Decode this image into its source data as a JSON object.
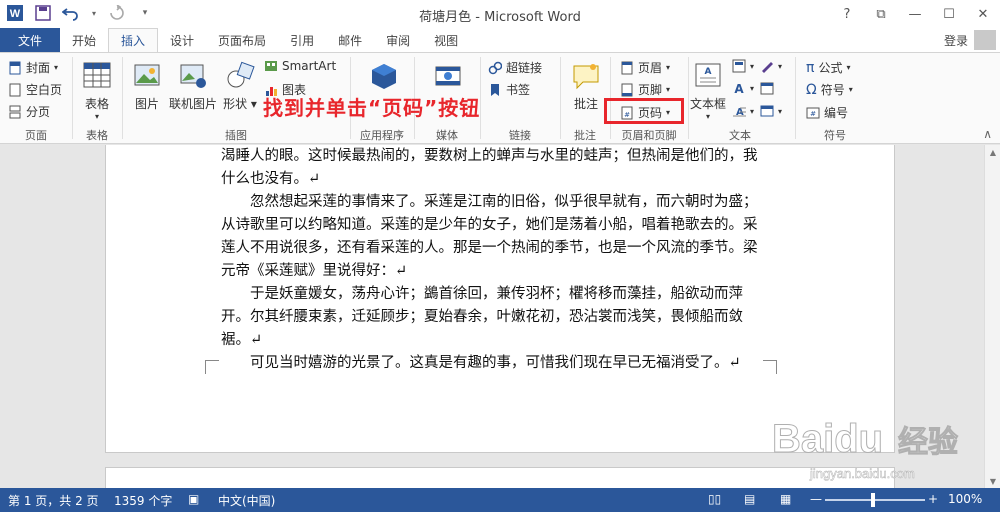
{
  "window": {
    "title": "荷塘月色 - Microsoft Word",
    "controls": {
      "help": "?",
      "restore_ribbon": "⧉",
      "minimize": "—",
      "maximize": "☐",
      "close": "✕"
    }
  },
  "tabs": {
    "file": "文件",
    "items": [
      "开始",
      "插入",
      "设计",
      "页面布局",
      "引用",
      "邮件",
      "审阅",
      "视图"
    ],
    "active": "插入",
    "login": "登录"
  },
  "ribbon": {
    "pages": {
      "cover": "封面",
      "blank": "空白页",
      "break": "分页",
      "label": "页面"
    },
    "tables": {
      "table": "表格",
      "label": "表格"
    },
    "illustrations": {
      "picture": "图片",
      "online_picture": "联机图片",
      "shapes": "形状",
      "smartart": "SmartArt",
      "chart": "图表",
      "label": "插图"
    },
    "apps": {
      "label": "应用程序"
    },
    "media": {
      "label": "媒体"
    },
    "links": {
      "hyperlink": "超链接",
      "bookmark": "书签",
      "label": "链接"
    },
    "comments": {
      "comment": "批注",
      "label": "批注"
    },
    "header_footer": {
      "header": "页眉",
      "footer": "页脚",
      "page_number": "页码",
      "label": "页眉和页脚"
    },
    "text": {
      "textbox": "文本框",
      "label": "文本"
    },
    "symbols": {
      "equation": "公式",
      "symbol": "符号",
      "numbering": "编号",
      "label": "符号"
    }
  },
  "annotation": "找到并单击“页码”按钮",
  "document": {
    "paragraphs": [
      "渴睡人的眼。这时候最热闹的，要数树上的蝉声与水里的蛙声；但热闹是他们的，我什么也没有。↵",
      "忽然想起采莲的事情来了。采莲是江南的旧俗，似乎很早就有，而六朝时为盛；从诗歌里可以约略知道。采莲的是少年的女子，她们是荡着小船，唱着艳歌去的。采莲人不用说很多，还有看采莲的人。那是一个热闹的季节，也是一个风流的季节。梁元帝《采莲赋》里说得好：↵",
      "于是妖童媛女，荡舟心许；鷁首徐回，兼传羽杯；欋将移而藻挂，船欲动而萍开。尔其纤腰束素，迁延顾步；夏始春余，叶嫩花初，恐沾裳而浅笑，畏倾船而敛裾。↵",
      "可见当时嬉游的光景了。这真是有趣的事，可惜我们现在早已无福消受了。↵"
    ]
  },
  "watermark": {
    "brand": "Baidu",
    "cn": "经验",
    "url": "jingyan.baidu.com"
  },
  "status": {
    "page": "第 1 页，共 2 页",
    "words": "1359 个字",
    "language": "中文(中国)",
    "zoom": "100%",
    "zoom_minus": "—",
    "zoom_plus": "+"
  },
  "colors": {
    "accent": "#2b579a",
    "annotation": "#e8262c"
  }
}
